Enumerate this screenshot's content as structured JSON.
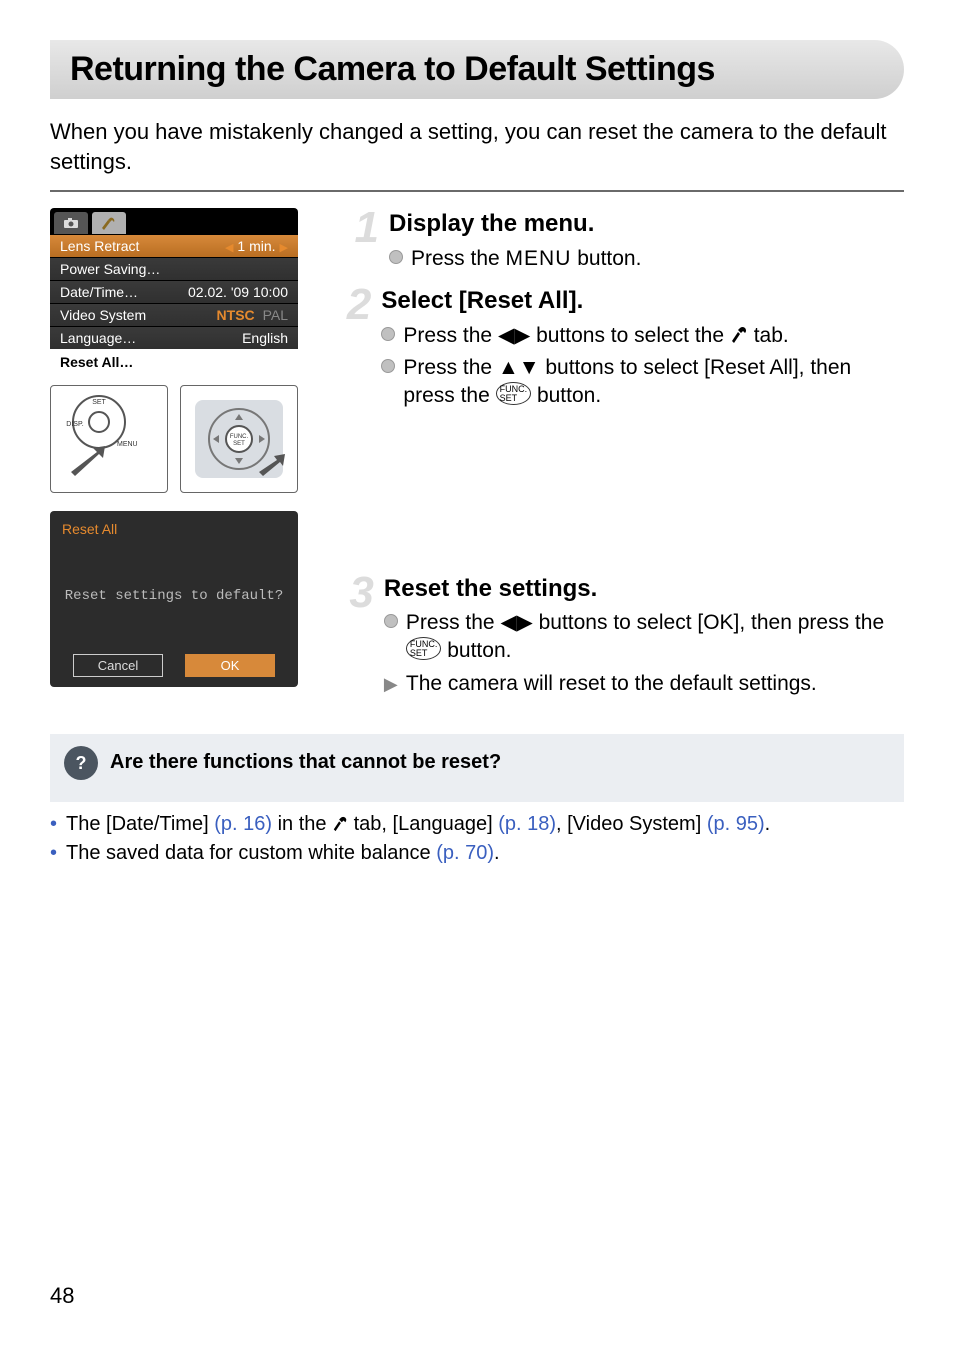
{
  "page": {
    "title": "Returning the Camera to Default Settings",
    "intro": "When you have mistakenly changed a setting, you can reset the camera to the default settings.",
    "page_number": "48"
  },
  "menu_screenshot": {
    "tab_camera_icon": "camera",
    "tab_tools_icon": "wrench-hammer",
    "rows": {
      "lens_retract": {
        "label": "Lens Retract",
        "value": "1 min."
      },
      "power_saving": {
        "label": "Power Saving…",
        "value": ""
      },
      "date_time": {
        "label": "Date/Time…",
        "value": "02.02. '09 10:00"
      },
      "video_system": {
        "label": "Video System",
        "selected": "NTSC",
        "other": "PAL"
      },
      "language": {
        "label": "Language…",
        "value": "English"
      },
      "reset_all": {
        "label": "Reset All…",
        "value": ""
      }
    }
  },
  "reset_dialog": {
    "title": "Reset All",
    "prompt": "Reset settings to default?",
    "cancel": "Cancel",
    "ok": "OK"
  },
  "steps": {
    "s1": {
      "num": "1",
      "title": "Display the menu.",
      "line1_pre": "Press the ",
      "menu_word": "MENU",
      "line1_post": " button."
    },
    "s2": {
      "num": "2",
      "title": "Select [Reset All].",
      "line1_pre": "Press the ",
      "line1_mid": " buttons to select the ",
      "line1_post": " tab.",
      "line2_pre": "Press the ",
      "line2_mid": " buttons to select [Reset All], then press the ",
      "line2_post": " button."
    },
    "s3": {
      "num": "3",
      "title": "Reset the settings.",
      "line1_pre": "Press the ",
      "line1_mid": " buttons to select [OK], then press the ",
      "line1_post": " button.",
      "line2": "The camera will reset to the default settings."
    }
  },
  "tip": {
    "heading": "Are there functions that cannot be reset?",
    "item1": {
      "a": "The [Date/Time] ",
      "ref1": "(p. 16)",
      "b": " in the ",
      "c": " tab, [Language] ",
      "ref2": "(p. 18)",
      "d": ", [Video System] ",
      "ref3": "(p. 95)",
      "e": "."
    },
    "item2": {
      "a": "The saved data for custom white balance ",
      "ref1": "(p. 70)",
      "b": "."
    }
  },
  "icons": {
    "func_label": "FUNC.\nSET",
    "wrench_hammer": "🛠"
  }
}
